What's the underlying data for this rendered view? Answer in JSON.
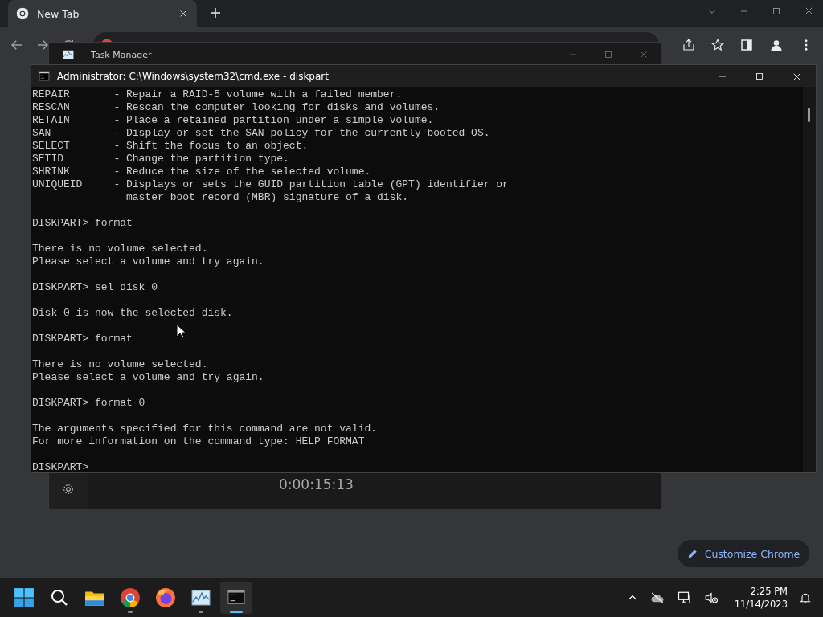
{
  "browser": {
    "tabs": [
      {
        "title": "New Tab",
        "selected": true
      }
    ],
    "customize_button": "Customize Chrome"
  },
  "task_manager": {
    "title": "Task Manager",
    "timer": "0:00:15:13"
  },
  "console": {
    "title": "Administrator: C:\\Windows\\system32\\cmd.exe - diskpart",
    "blocks": [
      [
        "REPAIR       - Repair a RAID-5 volume with a failed member.",
        "RESCAN       - Rescan the computer looking for disks and volumes.",
        "RETAIN       - Place a retained partition under a simple volume.",
        "SAN          - Display or set the SAN policy for the currently booted OS.",
        "SELECT       - Shift the focus to an object.",
        "SETID        - Change the partition type.",
        "SHRINK       - Reduce the size of the selected volume.",
        "UNIQUEID     - Displays or sets the GUID partition table (GPT) identifier or",
        "               master boot record (MBR) signature of a disk."
      ],
      [
        "DISKPART> format"
      ],
      [
        "There is no volume selected.",
        "Please select a volume and try again."
      ],
      [
        "DISKPART> sel disk 0"
      ],
      [
        "Disk 0 is now the selected disk."
      ],
      [
        "DISKPART> format"
      ],
      [
        "There is no volume selected.",
        "Please select a volume and try again."
      ],
      [
        "DISKPART> format 0"
      ],
      [
        "The arguments specified for this command are not valid.",
        "For more information on the command type: HELP FORMAT"
      ],
      [
        "DISKPART>"
      ]
    ]
  },
  "taskbar": {
    "apps": [
      {
        "kind": "start",
        "running": false,
        "selected": false
      },
      {
        "kind": "search",
        "running": false,
        "selected": false
      },
      {
        "kind": "explorer",
        "running": false,
        "selected": false
      },
      {
        "kind": "chrome",
        "running": true,
        "selected": false
      },
      {
        "kind": "firefox",
        "running": false,
        "selected": false
      },
      {
        "kind": "monitor",
        "running": true,
        "selected": false
      },
      {
        "kind": "terminal",
        "running": true,
        "selected": true
      }
    ],
    "time": "2:25 PM",
    "date": "11/14/2023"
  }
}
